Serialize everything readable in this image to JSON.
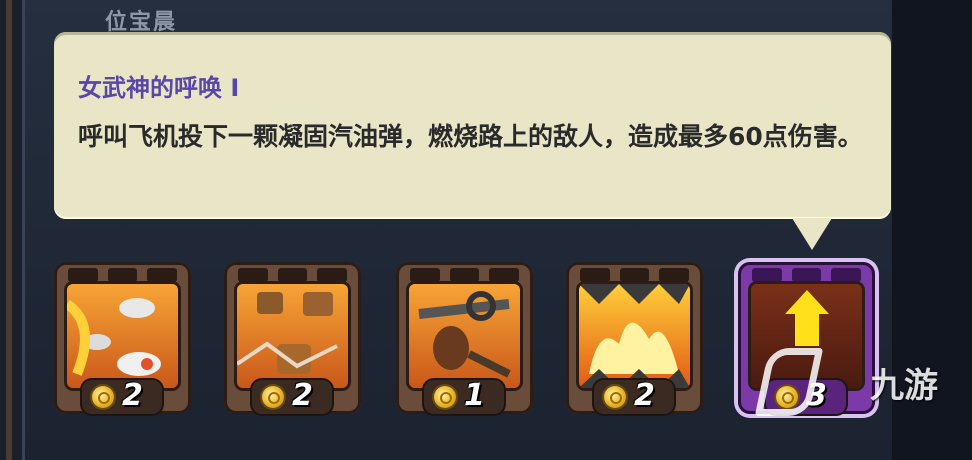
{
  "header": {
    "title": "位宝晨"
  },
  "tooltip": {
    "title": "女武神的呼唤 I",
    "description": "呼叫飞机投下一颗凝固汽油弹，燃烧路上的敌人，造成最多60点伤害。"
  },
  "skills": [
    {
      "name": "missile-strike",
      "cost": "2"
    },
    {
      "name": "rock-barrage",
      "cost": "2"
    },
    {
      "name": "chain-grapple",
      "cost": "1"
    },
    {
      "name": "fire-wall",
      "cost": "2"
    },
    {
      "name": "valkyrie-call-upgrade",
      "cost": "3"
    }
  ],
  "watermark": {
    "text": "九游"
  },
  "colors": {
    "tooltip_bg": "#e9e6c8",
    "title": "#5a46a8",
    "active_frame": "#7c3aa8"
  }
}
